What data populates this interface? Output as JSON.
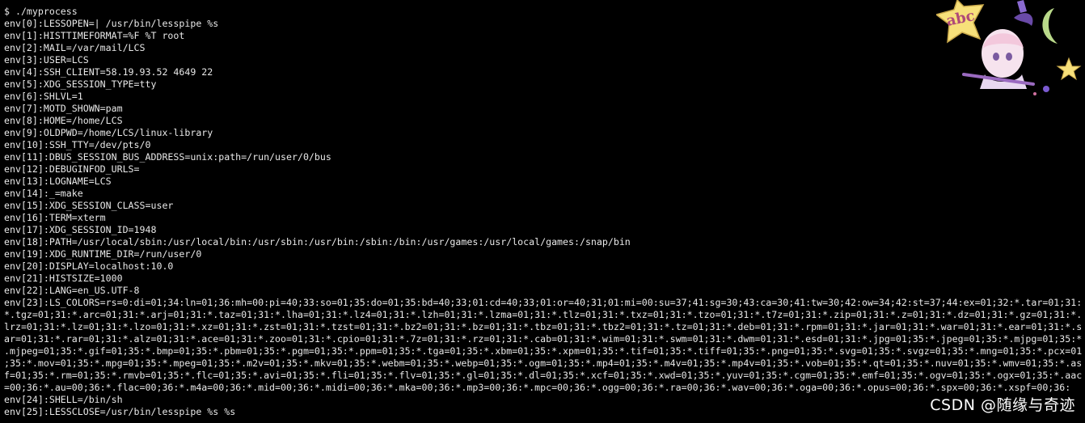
{
  "terminal": {
    "lines": [
      "$ ./myprocess",
      "env[0]:LESSOPEN=| /usr/bin/lesspipe %s",
      "env[1]:HISTTIMEFORMAT=%F %T root",
      "env[2]:MAIL=/var/mail/LCS",
      "env[3]:USER=LCS",
      "env[4]:SSH_CLIENT=58.19.93.52 4649 22",
      "env[5]:XDG_SESSION_TYPE=tty",
      "env[6]:SHLVL=1",
      "env[7]:MOTD_SHOWN=pam",
      "env[8]:HOME=/home/LCS",
      "env[9]:OLDPWD=/home/LCS/linux-library",
      "env[10]:SSH_TTY=/dev/pts/0",
      "env[11]:DBUS_SESSION_BUS_ADDRESS=unix:path=/run/user/0/bus",
      "env[12]:DEBUGINFOD_URLS=",
      "env[13]:LOGNAME=LCS",
      "env[14]:_=make",
      "env[15]:XDG_SESSION_CLASS=user",
      "env[16]:TERM=xterm",
      "env[17]:XDG_SESSION_ID=1948",
      "env[18]:PATH=/usr/local/sbin:/usr/local/bin:/usr/sbin:/usr/bin:/sbin:/bin:/usr/games:/usr/local/games:/snap/bin",
      "env[19]:XDG_RUNTIME_DIR=/run/user/0",
      "env[20]:DISPLAY=localhost:10.0",
      "env[21]:HISTSIZE=1000",
      "env[22]:LANG=en_US.UTF-8",
      "env[23]:LS_COLORS=rs=0:di=01;34:ln=01;36:mh=00:pi=40;33:so=01;35:do=01;35:bd=40;33;01:cd=40;33;01:or=40;31;01:mi=00:su=37;41:sg=30;43:ca=30;41:tw=30;42:ow=34;42:st=37;44:ex=01;32:*.tar=01;31:",
      "*.tgz=01;31:*.arc=01;31:*.arj=01;31:*.taz=01;31:*.lha=01;31:*.lz4=01;31:*.lzh=01;31:*.lzma=01;31:*.tlz=01;31:*.txz=01;31:*.tzo=01;31:*.t7z=01;31:*.zip=01;31:*.z=01;31:*.dz=01;31:*.gz=01;31:*.",
      "lrz=01;31:*.lz=01;31:*.lzo=01;31:*.xz=01;31:*.zst=01;31:*.tzst=01;31:*.bz2=01;31:*.bz=01;31:*.tbz=01;31:*.tbz2=01;31:*.tz=01;31:*.deb=01;31:*.rpm=01;31:*.jar=01;31:*.war=01;31:*.ear=01;31:*.s",
      "ar=01;31:*.rar=01;31:*.alz=01;31:*.ace=01;31:*.zoo=01;31:*.cpio=01;31:*.7z=01;31:*.rz=01;31:*.cab=01;31:*.wim=01;31:*.swm=01;31:*.dwm=01;31:*.esd=01;31:*.jpg=01;35:*.jpeg=01;35:*.mjpg=01;35:*",
      ".mjpeg=01;35:*.gif=01;35:*.bmp=01;35:*.pbm=01;35:*.pgm=01;35:*.ppm=01;35:*.tga=01;35:*.xbm=01;35:*.xpm=01;35:*.tif=01;35:*.tiff=01;35:*.png=01;35:*.svg=01;35:*.svgz=01;35:*.mng=01;35:*.pcx=01",
      ";35:*.mov=01;35:*.mpg=01;35:*.mpeg=01;35:*.m2v=01;35:*.mkv=01;35:*.webm=01;35:*.webp=01;35:*.ogm=01;35:*.mp4=01;35:*.m4v=01;35:*.mp4v=01;35:*.vob=01;35:*.qt=01;35:*.nuv=01;35:*.wmv=01;35:*.as",
      "f=01;35:*.rm=01;35:*.rmvb=01;35:*.flc=01;35:*.avi=01;35:*.fli=01;35:*.flv=01;35:*.gl=01;35:*.dl=01;35:*.xcf=01;35:*.xwd=01;35:*.yuv=01;35:*.cgm=01;35:*.emf=01;35:*.ogv=01;35:*.ogx=01;35:*.aac",
      "=00;36:*.au=00;36:*.flac=00;36:*.m4a=00;36:*.mid=00;36:*.midi=00;36:*.mka=00;36:*.mp3=00;36:*.mpc=00;36:*.ogg=00;36:*.ra=00;36:*.wav=00;36:*.oga=00;36:*.opus=00;36:*.spx=00;36:*.xspf=00;36:",
      "env[24]:SHELL=/bin/sh",
      "env[25]:LESSCLOSE=/usr/bin/lesspipe %s %s"
    ],
    "background": "#000000",
    "foreground": "#e8e8e8"
  },
  "sticker": {
    "text": "abc",
    "icon": "anime-girl-sticker-icon"
  },
  "watermark": {
    "text": "CSDN @随缘与奇迹"
  }
}
